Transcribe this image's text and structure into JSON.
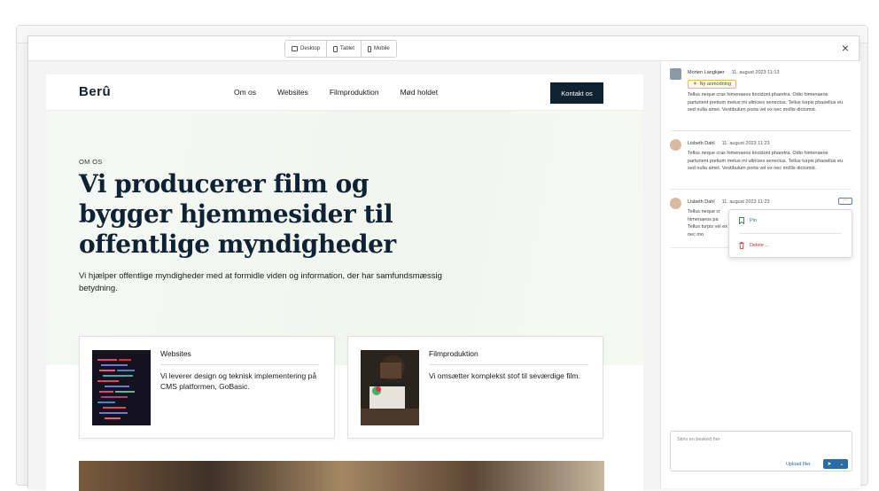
{
  "devices": [
    {
      "label": "Desktop",
      "icon": "monitor-icon"
    },
    {
      "label": "Tablet",
      "icon": "tablet-icon"
    },
    {
      "label": "Mobile",
      "icon": "mobile-icon"
    }
  ],
  "close_icon": "×",
  "site": {
    "logo": "Berû",
    "nav": [
      "Om os",
      "Websites",
      "Filmproduktion",
      "Mød holdet"
    ],
    "cta": "Kontakt os",
    "eyebrow": "OM OS",
    "headline": "Vi producerer film og bygger hjemmesider til offentlige myndigheder",
    "lead": "Vi hjælper offentlige myndigheder med at formidle viden og information, der har samfundsmæssig betydning.",
    "cards": [
      {
        "title": "Websites",
        "desc": "Vi leverer design og teknisk implementering på CMS platformen, GoBasic."
      },
      {
        "title": "Filmproduktion",
        "desc": "Vi omsætter komplekst stof til seværdige film."
      }
    ]
  },
  "comments": [
    {
      "author": "Morten Langkjær",
      "date": "11. august 2023 11:13",
      "badge": "Ny anmodning",
      "text": "Tellus neque cras himenaeos tincidunt pharetra. Odio himenaeos parturient pretium metus mi ultricies senectus. Tellus turpis phasellus eu sed nulla amet. Vestibulum porta vel ex nec mollis dictumst."
    },
    {
      "author": "Lisbeth Dahl",
      "date": "11. august 2023 11:23",
      "text": "Tellus neque cras himenaeos tincidunt pharetra. Odio himenaeos parturient pretium metus mi ultricies senectus. Tellus turpis phasellus eu sed nulla amet. Vestibulum porta vel ex nec mollis dictumst."
    },
    {
      "author": "Lisbeth Dahl",
      "date": "11. august 2023 11:23",
      "text": "Tellus neque cr himenaeos pa Tellus turpis vel ex nec mo",
      "more": "···"
    }
  ],
  "menu": {
    "pin": "Pin",
    "delete": "Delete ..."
  },
  "composer": {
    "placeholder": "Skriv en besked her",
    "upload": "Upload filer",
    "send_icon": "➤",
    "send_caret": "⌄"
  }
}
